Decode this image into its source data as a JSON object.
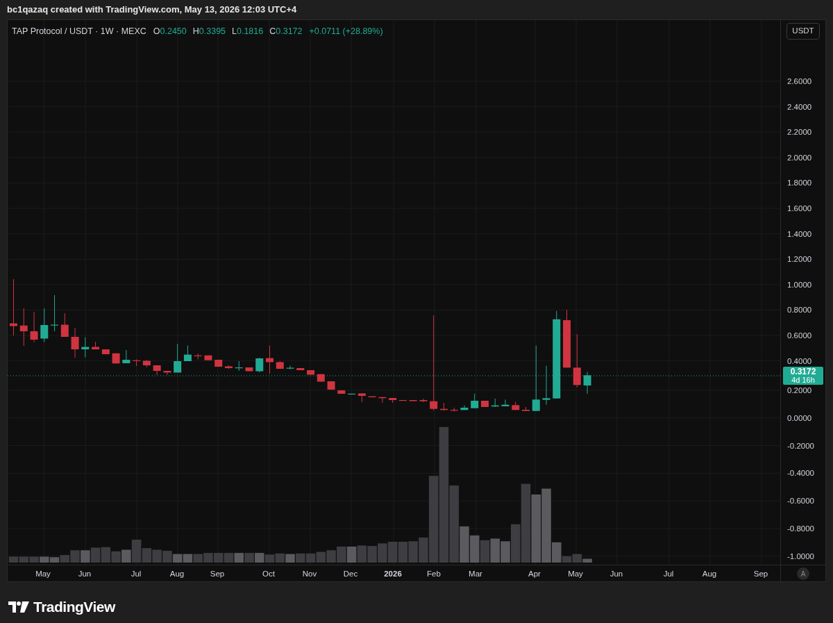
{
  "caption": "bc1qazaq created with TradingView.com, May 13, 2026 12:03 UTC+4",
  "legend": {
    "symbol": "TAP Protocol / USDT · 1W · MEXC",
    "up": true,
    "ohlc": [
      {
        "label": "O",
        "value": "0.2450"
      },
      {
        "label": "H",
        "value": "0.3395"
      },
      {
        "label": "L",
        "value": "0.1816"
      },
      {
        "label": "C",
        "value": "0.3172"
      }
    ],
    "change": "+0.0711 (+28.89%)"
  },
  "currency_button": "USDT",
  "price_axis": [
    "2.6000",
    "2.4000",
    "2.2000",
    "2.0000",
    "1.8000",
    "1.6000",
    "1.4000",
    "1.2000",
    "1.0000",
    "0.8000",
    "0.6000",
    "0.4000",
    "0.2000",
    "0.0000",
    "-0.2000",
    "-0.4000",
    "-0.6000",
    "-0.8000",
    "-1.0000"
  ],
  "last_price": {
    "price": "0.3172",
    "countdown": "4d 16h",
    "up": true
  },
  "time_axis": [
    "May",
    "Jun",
    "Jul",
    "Aug",
    "Sep",
    "Oct",
    "Nov",
    "Dec",
    "2026",
    "Feb",
    "Mar",
    "Apr",
    "May",
    "Jun",
    "Jul",
    "Aug",
    "Sep"
  ],
  "auto_scale_button": "A",
  "brand": "TradingView"
}
